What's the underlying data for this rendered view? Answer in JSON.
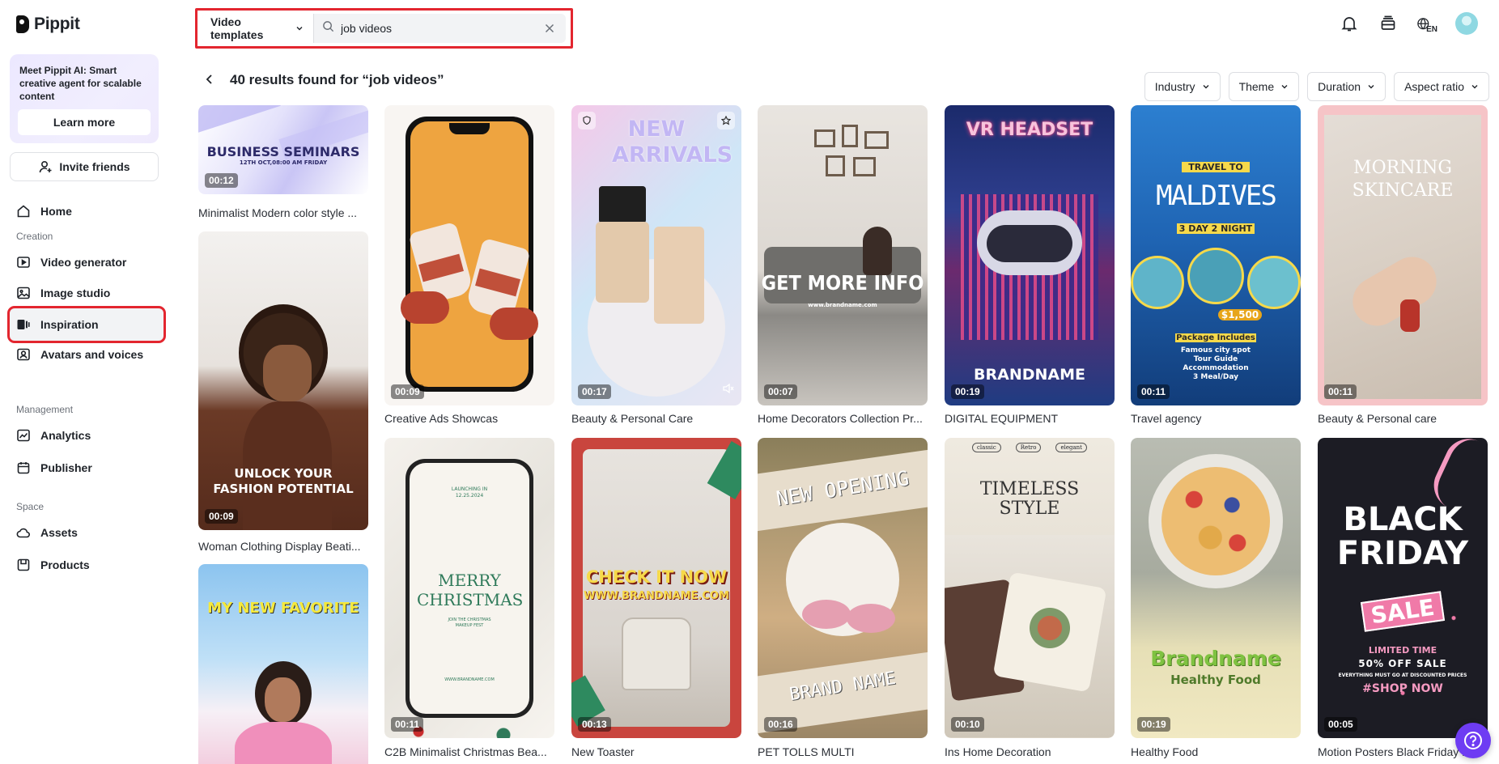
{
  "brand": {
    "name": "Pippit"
  },
  "sidebar": {
    "promo": {
      "text": "Meet Pippit AI: Smart creative agent for scalable content",
      "button": "Learn more"
    },
    "invite": "Invite friends",
    "home": "Home",
    "sections": {
      "creation": "Creation",
      "management": "Management",
      "space": "Space"
    },
    "creation_items": [
      "Video generator",
      "Image studio",
      "Inspiration",
      "Avatars and voices"
    ],
    "management_items": [
      "Analytics",
      "Publisher"
    ],
    "space_items": [
      "Assets",
      "Products"
    ]
  },
  "header": {
    "type_select": "Video templates",
    "search_value": "job videos",
    "lang": "EN"
  },
  "results": {
    "title": "40 results found for “job videos”",
    "filters": [
      "Industry",
      "Theme",
      "Duration",
      "Aspect ratio"
    ]
  },
  "cards": [
    {
      "title": "Minimalist Modern color style ...",
      "duration": "00:12",
      "overlay": "BUSINESS SEMINARS",
      "sub": "12TH OCT,08:00 AM FRIDAY"
    },
    {
      "title": "Woman Clothing Display Beati...",
      "duration": "00:09",
      "overlay": "UNLOCK YOUR FASHION POTENTIAL"
    },
    {
      "title": "",
      "duration": "",
      "overlay": "MY NEW FAVORITE"
    },
    {
      "title": "Creative Ads Showcas",
      "duration": "00:09"
    },
    {
      "title": "C2B Minimalist Christmas Bea...",
      "duration": "00:11",
      "overlay": "MERRY CHRISTMAS",
      "sub": "LAUNCHING IN 12.25.2024",
      "sub2": "JOIN THE CHRISTMAS MAKEUP FEST",
      "url": "WWW.BRANDNAME.COM"
    },
    {
      "title": "Beauty & Personal Care",
      "duration": "00:17",
      "overlay": "NEW ARRIVALS"
    },
    {
      "title": "New Toaster",
      "duration": "00:13",
      "overlay": "CHECK IT NOW",
      "sub": "WWW.BRANDNAME.COM"
    },
    {
      "title": "Home Decorators Collection Pr...",
      "duration": "00:07",
      "overlay": "GET MORE INFO",
      "sub": "www.brandname.com"
    },
    {
      "title": "PET TOLLS MULTI",
      "duration": "00:16",
      "overlay": "NEW OPENING",
      "sub": "BRAND NAME"
    },
    {
      "title": "DIGITAL EQUIPMENT",
      "duration": "00:19",
      "overlay": "VR HEADSET",
      "sub": "BRANDNAME"
    },
    {
      "title": "Ins Home Decoration",
      "duration": "00:10",
      "overlay": "TIMELESS STYLE",
      "tags": [
        "classic",
        "Retro",
        "elegant"
      ]
    },
    {
      "title": "Travel agency",
      "duration": "00:11",
      "overlay": "MALDIVES",
      "sub": "TRAVEL TO",
      "sub2": "3 DAY 2 NIGHT",
      "price": "$1,500",
      "package": "Package Includes",
      "lines": [
        "Famous city spot",
        "Tour Guide",
        "Accommodation",
        "3 Meal/Day"
      ]
    },
    {
      "title": "Healthy Food",
      "duration": "00:19",
      "overlay": "Brandname",
      "sub": "Healthy Food"
    },
    {
      "title": "Beauty & Personal care",
      "duration": "00:11",
      "overlay": "MORNING SKINCARE"
    },
    {
      "title": "Motion Posters Black Friday M...",
      "duration": "00:05",
      "overlay": "BLACK FRIDAY",
      "sub": "SALE",
      "lines": [
        "LIMITED TIME",
        "50% OFF SALE",
        "EVERYTHING MUST GO AT DISCOUNTED PRICES",
        "#SHOP NOW"
      ]
    }
  ],
  "colors": {
    "accent": "#e3262f",
    "help": "#6e3cf3"
  }
}
